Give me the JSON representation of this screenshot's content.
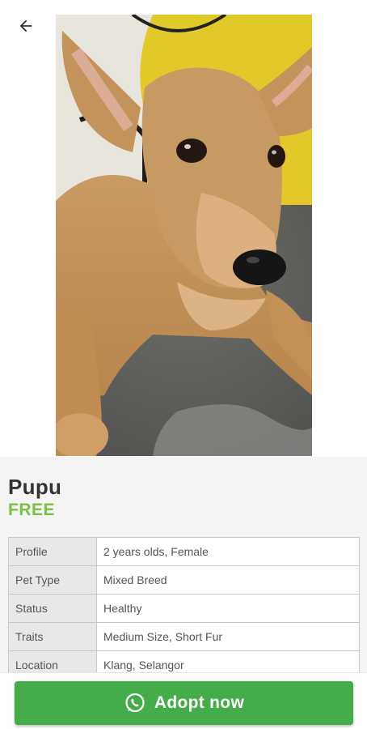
{
  "header": {
    "back_icon": "arrow-left-icon"
  },
  "photo": {
    "subject": "dog-photo"
  },
  "pet": {
    "name": "Pupu",
    "price": "FREE"
  },
  "details": [
    {
      "label": "Profile",
      "value": "2 years olds, Female"
    },
    {
      "label": "Pet Type",
      "value": "Mixed Breed"
    },
    {
      "label": "Status",
      "value": "Healthy"
    },
    {
      "label": "Traits",
      "value": "Medium Size, Short Fur"
    },
    {
      "label": "Location",
      "value": "Klang, Selangor"
    }
  ],
  "action": {
    "icon": "whatsapp-icon",
    "label": "Adopt now"
  },
  "colors": {
    "accent_green": "#7ac142",
    "button_green": "#44ad4a"
  }
}
